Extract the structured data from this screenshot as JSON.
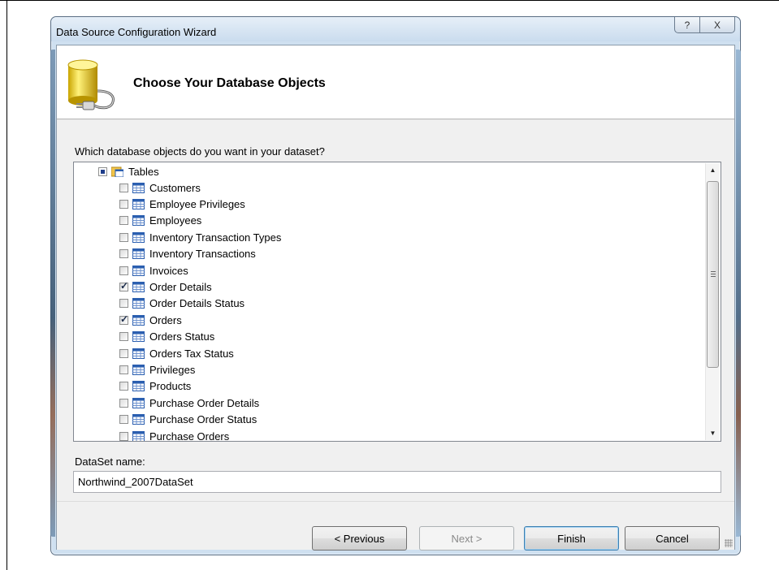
{
  "window": {
    "title": "Data Source Configuration Wizard",
    "help_glyph": "?",
    "close_glyph": "X"
  },
  "header": {
    "title": "Choose Your Database Objects",
    "icon": "database-connect-icon"
  },
  "question": "Which database objects do you want in your dataset?",
  "tree": {
    "root": {
      "label": "Tables",
      "state": "partial",
      "icon": "tables-folder-icon"
    },
    "items": [
      {
        "label": "Customers",
        "checked": false
      },
      {
        "label": "Employee Privileges",
        "checked": false
      },
      {
        "label": "Employees",
        "checked": false
      },
      {
        "label": "Inventory Transaction Types",
        "checked": false
      },
      {
        "label": "Inventory Transactions",
        "checked": false
      },
      {
        "label": "Invoices",
        "checked": false
      },
      {
        "label": "Order Details",
        "checked": true
      },
      {
        "label": "Order Details Status",
        "checked": false
      },
      {
        "label": "Orders",
        "checked": true
      },
      {
        "label": "Orders Status",
        "checked": false
      },
      {
        "label": "Orders Tax Status",
        "checked": false
      },
      {
        "label": "Privileges",
        "checked": false
      },
      {
        "label": "Products",
        "checked": false
      },
      {
        "label": "Purchase Order Details",
        "checked": false
      },
      {
        "label": "Purchase Order Status",
        "checked": false
      },
      {
        "label": "Purchase Orders",
        "checked": false
      }
    ]
  },
  "dataset": {
    "label": "DataSet name:",
    "value": "Northwind_2007DataSet"
  },
  "buttons": {
    "previous": "< Previous",
    "next": "Next >",
    "finish": "Finish",
    "cancel": "Cancel"
  }
}
